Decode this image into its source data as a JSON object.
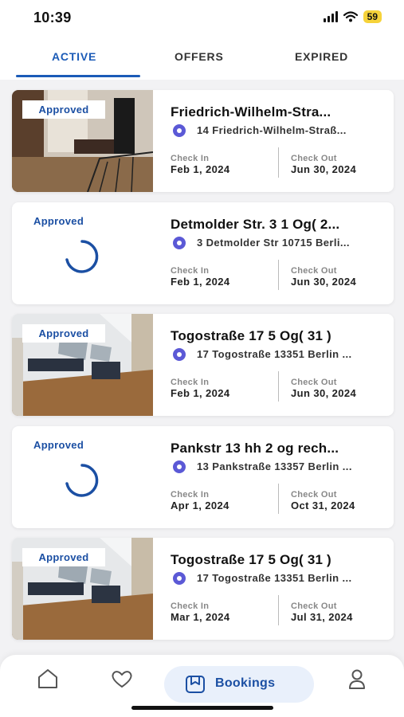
{
  "status_bar": {
    "time": "10:39",
    "battery": "59"
  },
  "tabs": [
    {
      "label": "ACTIVE",
      "active": true
    },
    {
      "label": "OFFERS",
      "active": false
    },
    {
      "label": "EXPIRED",
      "active": false
    }
  ],
  "bookings": [
    {
      "status": "Approved",
      "has_image": true,
      "title": "Friedrich-Wilhelm-Stra...",
      "address": "14 Friedrich-Wilhelm-Straß...",
      "check_in_label": "Check In",
      "check_in": "Feb 1, 2024",
      "check_out_label": "Check Out",
      "check_out": "Jun 30, 2024"
    },
    {
      "status": "Approved",
      "has_image": false,
      "title": "Detmolder Str. 3 1 Og( 2...",
      "address": "3 Detmolder Str 10715 Berli...",
      "check_in_label": "Check In",
      "check_in": "Feb 1, 2024",
      "check_out_label": "Check Out",
      "check_out": "Jun 30, 2024"
    },
    {
      "status": "Approved",
      "has_image": true,
      "title": "Togostraße 17 5 Og( 31 )",
      "address": "17 Togostraße 13351 Berlin ...",
      "check_in_label": "Check In",
      "check_in": "Feb 1, 2024",
      "check_out_label": "Check Out",
      "check_out": "Jun 30, 2024"
    },
    {
      "status": "Approved",
      "has_image": false,
      "title": "Pankstr 13 hh 2 og rech...",
      "address": "13 Pankstraße 13357 Berlin ...",
      "check_in_label": "Check In",
      "check_in": "Apr 1, 2024",
      "check_out_label": "Check Out",
      "check_out": "Oct 31, 2024"
    },
    {
      "status": "Approved",
      "has_image": true,
      "title": "Togostraße 17 5 Og( 31 )",
      "address": "17 Togostraße 13351 Berlin ...",
      "check_in_label": "Check In",
      "check_in": "Mar 1, 2024",
      "check_out_label": "Check Out",
      "check_out": "Jul 31, 2024"
    }
  ],
  "bottom_nav": {
    "items": [
      {
        "icon": "home-icon"
      },
      {
        "icon": "heart-tag-icon"
      },
      {
        "icon": "bookings-icon",
        "label": "Bookings",
        "active": true
      },
      {
        "icon": "profile-icon"
      }
    ]
  },
  "colors": {
    "accent": "#1b5bb7",
    "badge_text": "#1b4fa3",
    "pin": "#5b59d6",
    "battery": "#f6d33a"
  }
}
